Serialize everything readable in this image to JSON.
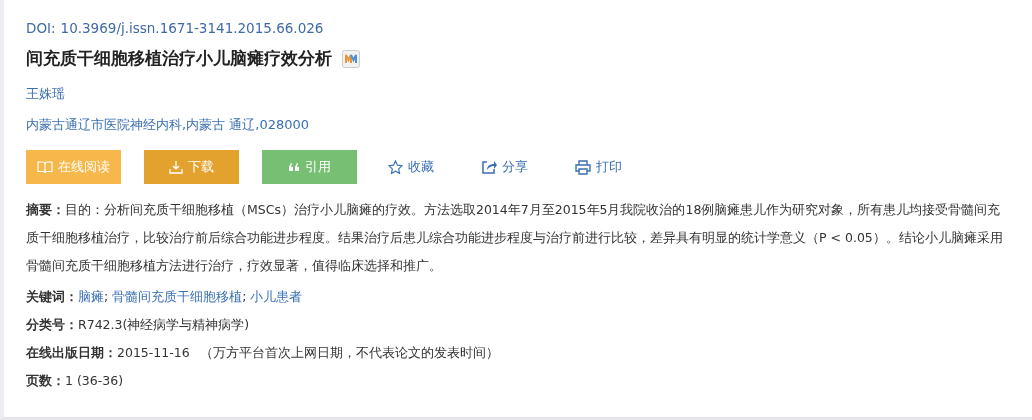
{
  "doi": {
    "label": "DOI:",
    "value": "10.3969/j.issn.1671-3141.2015.66.026"
  },
  "title": "间充质干细胞移植治疗小儿脑瘫疗效分析",
  "author": "王姝瑶",
  "affiliation": "内蒙古通辽市医院神经内科,内蒙古 通辽,028000",
  "actions": [
    {
      "kind": "read",
      "label": "在线阅读"
    },
    {
      "kind": "download",
      "label": "下载"
    },
    {
      "kind": "cite",
      "label": "引用"
    },
    {
      "kind": "collect",
      "label": "收藏"
    },
    {
      "kind": "share",
      "label": "分享"
    },
    {
      "kind": "print",
      "label": "打印"
    }
  ],
  "abstract": {
    "label": "摘要：",
    "text": "目的：分析间充质干细胞移植（MSCs）治疗小儿脑瘫的疗效。方法选取2014年7月至2015年5月我院收治的18例脑瘫患儿作为研究对象，所有患儿均接受骨髓间充质干细胞移植治疗，比较治疗前后综合功能进步程度。结果治疗后患儿综合功能进步程度与治疗前进行比较，差异具有明显的统计学意义（P < 0.05）。结论小儿脑瘫采用骨髓间充质干细胞移植方法进行治疗，疗效显著，值得临床选择和推广。"
  },
  "keywords": {
    "label": "关键词：",
    "separator": ";",
    "items": [
      "脑瘫",
      "骨髓间充质干细胞移植",
      "小儿患者"
    ]
  },
  "classification": {
    "label": "分类号：",
    "value": "R742.3(神经病学与精神病学)"
  },
  "online_date": {
    "label": "在线出版日期：",
    "value": "2015-11-16",
    "note": "（万方平台首次上网日期，不代表论文的发表时间）"
  },
  "pages": {
    "label": "页数：",
    "value": "1 (36-36)"
  }
}
